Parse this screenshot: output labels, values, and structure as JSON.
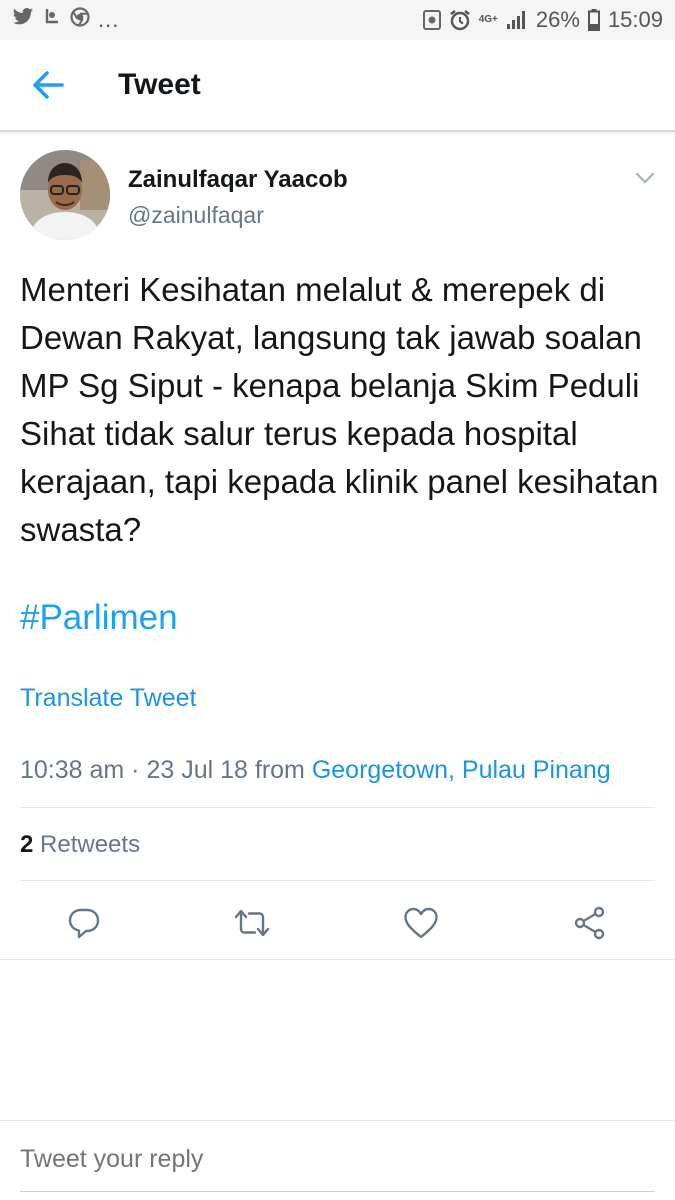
{
  "status_bar": {
    "battery": "26%",
    "time": "15:09",
    "network": "4G+",
    "overflow": "..."
  },
  "app_bar": {
    "title": "Tweet"
  },
  "tweet": {
    "author_name": "Zainulfaqar Yaacob",
    "author_handle": "@zainulfaqar",
    "text": "Menteri Kesihatan melalut & merepek di Dewan Rakyat, langsung tak jawab soalan MP Sg Siput - kenapa belanja Skim Peduli Sihat tidak salur terus kepada hospital kerajaan, tapi kepada klinik panel kesihatan swasta?",
    "hashtag": "#Parlimen",
    "translate_label": "Translate Tweet",
    "timestamp": "10:38 am · 23 Jul 18",
    "from_label": "from",
    "location": "Georgetown, Pulau Pinang",
    "retweet_count": "2",
    "retweet_label": "Retweets"
  },
  "actions": {
    "icons": [
      "reply-icon",
      "retweet-icon",
      "like-icon",
      "share-icon"
    ]
  },
  "reply": {
    "placeholder": "Tweet your reply"
  },
  "colors": {
    "accent": "#1da1f2",
    "link": "#1b95e0",
    "secondary_text": "#657786",
    "primary_text": "#14171a",
    "divider": "#e1e8ed"
  }
}
